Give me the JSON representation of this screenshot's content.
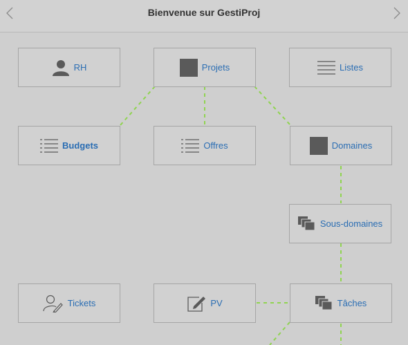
{
  "header": {
    "title": "Bienvenue sur GestiProj",
    "prev_icon": "chevron-left-icon",
    "next_icon": "chevron-right-icon"
  },
  "colors": {
    "link": "#2a6db3",
    "connector": "#8fd44f",
    "icon": "#5a5a5a"
  },
  "nodes": [
    {
      "id": "rh",
      "label": "RH",
      "icon": "user-icon"
    },
    {
      "id": "projets",
      "label": "Projets",
      "icon": "square-icon"
    },
    {
      "id": "listes",
      "label": "Listes",
      "icon": "list-icon"
    },
    {
      "id": "budgets",
      "label": "Budgets",
      "icon": "list-icon",
      "bold": true
    },
    {
      "id": "offres",
      "label": "Offres",
      "icon": "list-icon"
    },
    {
      "id": "domaines",
      "label": "Domaines",
      "icon": "square-icon"
    },
    {
      "id": "sous-domaines",
      "label": "Sous-domaines",
      "icon": "stack-icon"
    },
    {
      "id": "tickets",
      "label": "Tickets",
      "icon": "user-edit-icon"
    },
    {
      "id": "pv",
      "label": "PV",
      "icon": "edit-icon"
    },
    {
      "id": "taches",
      "label": "Tâches",
      "icon": "stack-icon"
    }
  ]
}
